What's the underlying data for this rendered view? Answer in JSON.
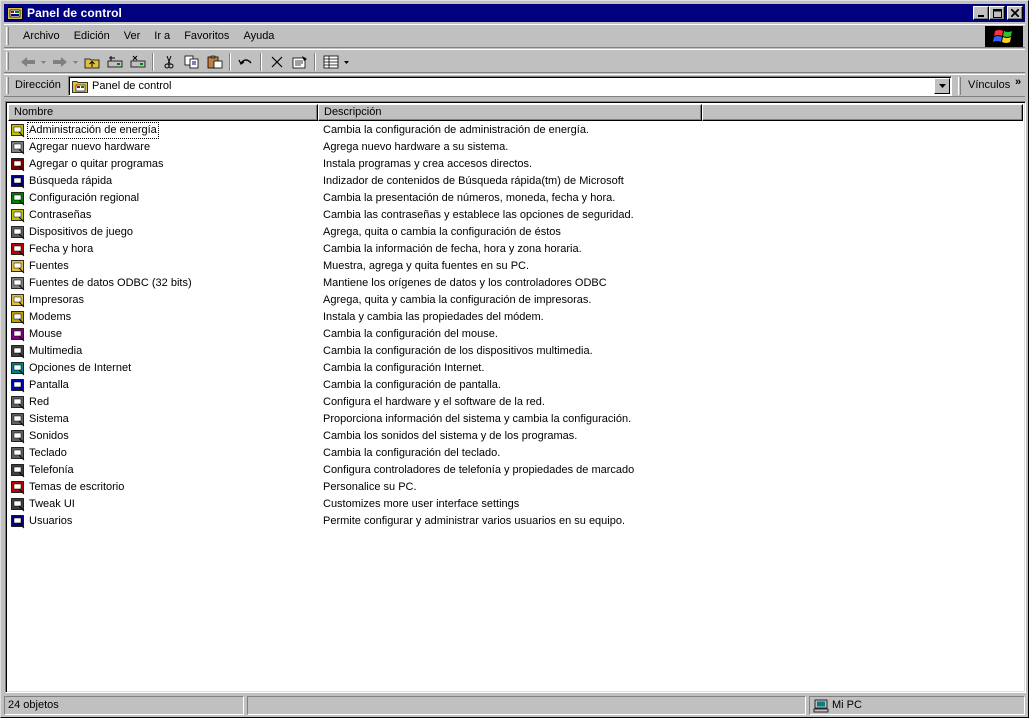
{
  "window": {
    "title": "Panel de control"
  },
  "menu": [
    "Archivo",
    "Edición",
    "Ver",
    "Ir a",
    "Favoritos",
    "Ayuda"
  ],
  "address": {
    "label": "Dirección",
    "value": "Panel de control",
    "links_label": "Vínculos",
    "links_chevron": "»"
  },
  "columns": {
    "name": "Nombre",
    "description": "Descripción"
  },
  "items": [
    {
      "name": "Administración de energía",
      "description": "Cambia la configuración de administración de energía.",
      "icon": "power-icon",
      "color": "#c0c000"
    },
    {
      "name": "Agregar nuevo hardware",
      "description": "Agrega nuevo hardware a su sistema.",
      "icon": "hardware-icon",
      "color": "#808080"
    },
    {
      "name": "Agregar o quitar programas",
      "description": "Instala programas y crea accesos directos.",
      "icon": "programs-icon",
      "color": "#800000"
    },
    {
      "name": "Búsqueda rápida",
      "description": "Indizador de contenidos de Búsqueda rápida(tm) de Microsoft",
      "icon": "binoculars-icon",
      "color": "#000080"
    },
    {
      "name": "Configuración regional",
      "description": "Cambia la presentación de números, moneda, fecha y hora.",
      "icon": "globe-icon",
      "color": "#008000"
    },
    {
      "name": "Contraseñas",
      "description": "Cambia las contraseñas y establece las opciones de seguridad.",
      "icon": "keys-icon",
      "color": "#c0c000"
    },
    {
      "name": "Dispositivos de juego",
      "description": "Agrega, quita o cambia la configuración de éstos",
      "icon": "joystick-icon",
      "color": "#606060"
    },
    {
      "name": "Fecha y hora",
      "description": "Cambia la información de fecha, hora y zona horaria.",
      "icon": "calendar-icon",
      "color": "#c00000"
    },
    {
      "name": "Fuentes",
      "description": "Muestra, agrega y quita fuentes en su PC.",
      "icon": "fonts-folder-icon",
      "color": "#e0c040"
    },
    {
      "name": "Fuentes de datos ODBC (32 bits)",
      "description": "Mantiene los orígenes de datos y los controladores ODBC",
      "icon": "odbc-icon",
      "color": "#808080"
    },
    {
      "name": "Impresoras",
      "description": "Agrega, quita y cambia la configuración de impresoras.",
      "icon": "printer-folder-icon",
      "color": "#e0c040"
    },
    {
      "name": "Modems",
      "description": "Instala y cambia las propiedades del módem.",
      "icon": "modem-icon",
      "color": "#c0a000"
    },
    {
      "name": "Mouse",
      "description": "Cambia la configuración del mouse.",
      "icon": "mouse-icon",
      "color": "#800080"
    },
    {
      "name": "Multimedia",
      "description": "Cambia la configuración de los dispositivos multimedia.",
      "icon": "multimedia-icon",
      "color": "#404040"
    },
    {
      "name": "Opciones de Internet",
      "description": "Cambia la configuración Internet.",
      "icon": "internet-icon",
      "color": "#008080"
    },
    {
      "name": "Pantalla",
      "description": "Cambia la configuración de pantalla.",
      "icon": "display-icon",
      "color": "#0000c0"
    },
    {
      "name": "Red",
      "description": "Configura el hardware y el software de la red.",
      "icon": "network-icon",
      "color": "#606060"
    },
    {
      "name": "Sistema",
      "description": "Proporciona información del sistema y cambia la configuración.",
      "icon": "system-icon",
      "color": "#606060"
    },
    {
      "name": "Sonidos",
      "description": "Cambia los sonidos del sistema y de los programas.",
      "icon": "speaker-icon",
      "color": "#606060"
    },
    {
      "name": "Teclado",
      "description": "Cambia la configuración del teclado.",
      "icon": "keyboard-icon",
      "color": "#606060"
    },
    {
      "name": "Telefonía",
      "description": "Configura controladores de telefonía y propiedades de marcado",
      "icon": "telephony-icon",
      "color": "#404040"
    },
    {
      "name": "Temas de escritorio",
      "description": "Personalice su PC.",
      "icon": "themes-icon",
      "color": "#c00000"
    },
    {
      "name": "Tweak UI",
      "description": "Customizes more user interface settings",
      "icon": "tweakui-icon",
      "color": "#404040"
    },
    {
      "name": "Usuarios",
      "description": "Permite configurar y administrar varios usuarios en su equipo.",
      "icon": "users-icon",
      "color": "#000080"
    }
  ],
  "status": {
    "count": "24 objetos",
    "zone": "Mi PC"
  }
}
